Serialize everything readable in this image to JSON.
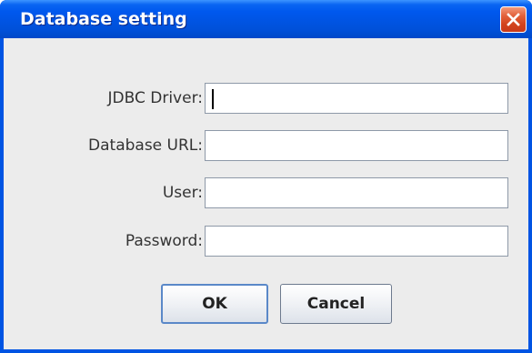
{
  "window": {
    "title": "Database setting",
    "close_icon": "close-x-icon",
    "title_gradient_color": "#0054e3",
    "close_button_color": "#d2431c"
  },
  "form": {
    "fields": [
      {
        "label": "JDBC Driver:",
        "value": "",
        "focused": true
      },
      {
        "label": "Database URL:",
        "value": ""
      },
      {
        "label": "User:",
        "value": ""
      },
      {
        "label": "Password:",
        "value": ""
      }
    ]
  },
  "buttons": {
    "ok_label": "OK",
    "cancel_label": "Cancel"
  }
}
